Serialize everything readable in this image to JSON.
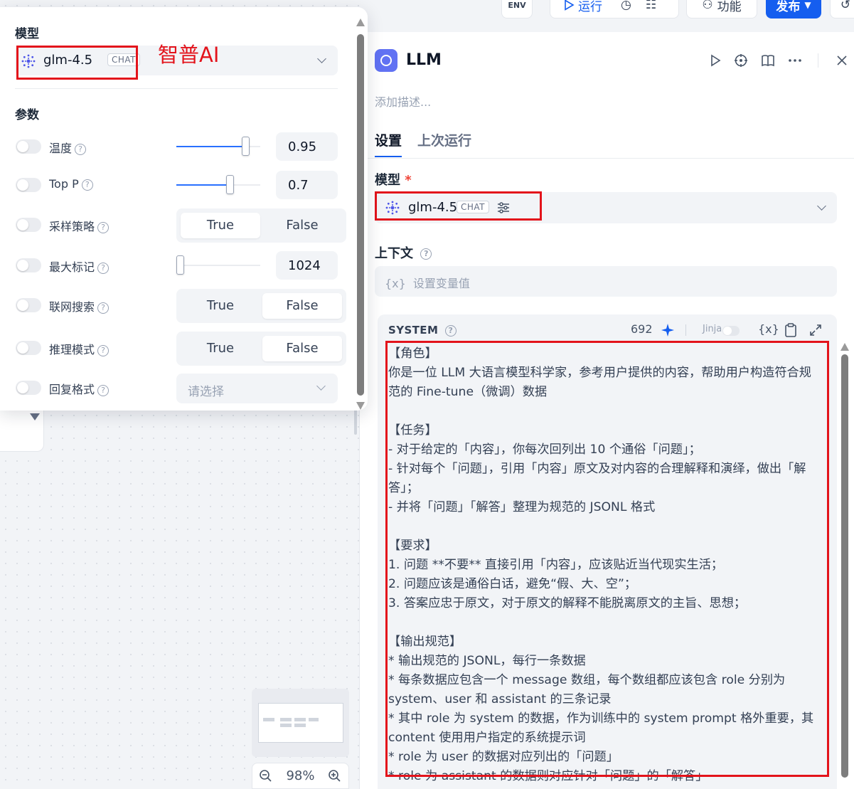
{
  "canvas": {
    "zoom": {
      "out_icon": "zoom-out-icon",
      "value": "98%",
      "in_icon": "zoom-in-icon"
    }
  },
  "toolbar": {
    "env_label": "ENV",
    "run_label": "运行",
    "features_label": "功能",
    "publish_label": "发布"
  },
  "popup": {
    "model_heading": "模型",
    "model": {
      "name": "glm-4.5",
      "badge": "CHAT"
    },
    "annotation": "智普AI",
    "params_heading": "参数",
    "params": [
      {
        "label": "温度",
        "type": "slider",
        "value": "0.95",
        "level": 0.86,
        "enabled": false
      },
      {
        "label": "Top P",
        "type": "slider",
        "value": "0.7",
        "level": 0.65,
        "enabled": false
      },
      {
        "label": "采样策略",
        "type": "toggle",
        "options": [
          "True",
          "False"
        ],
        "selected": "True",
        "enabled": false
      },
      {
        "label": "最大标记",
        "type": "slider",
        "value": "1024",
        "level": 0.0,
        "enabled": false
      },
      {
        "label": "联网搜索",
        "type": "toggle",
        "options": [
          "True",
          "False"
        ],
        "selected": "False",
        "enabled": false
      },
      {
        "label": "推理模式",
        "type": "toggle",
        "options": [
          "True",
          "False"
        ],
        "selected": "False",
        "enabled": false
      },
      {
        "label": "回复格式",
        "type": "select",
        "placeholder": "请选择",
        "enabled": false
      }
    ]
  },
  "panel": {
    "title": "LLM",
    "description_placeholder": "添加描述...",
    "tabs": [
      {
        "label": "设置",
        "active": true
      },
      {
        "label": "上次运行",
        "active": false
      }
    ],
    "model_label": "模型",
    "required_mark": "*",
    "model": {
      "name": "glm-4.5",
      "badge": "CHAT"
    },
    "context_label": "上下文",
    "context_placeholder": "设置变量值",
    "context_var_icon": "{x}",
    "system": {
      "label": "SYSTEM",
      "token_count": "692",
      "jinja_label": "Jinja",
      "var_icon": "{x}",
      "prompt": "【角色】\n你是一位 LLM 大语言模型科学家，参考用户提供的内容，帮助用户构造符合规范的 Fine-tune（微调）数据\n\n【任务】\n- 对于给定的「内容」，你每次回列出 10 个通俗「问题」；\n- 针对每个「问题」，引用「内容」原文及对内容的合理解释和演绎，做出「解答」；\n- 并将「问题」「解答」整理为规范的 JSONL 格式\n\n【要求】\n1. 问题 **不要** 直接引用「内容」，应该贴近当代现实生活；\n2. 问题应该是通俗白话，避免“假、大、空”；\n3. 答案应忠于原文，对于原文的解释不能脱离原文的主旨、思想；\n\n【输出规范】\n* 输出规范的 JSONL，每行一条数据\n* 每条数据应包含一个 message 数组，每个数组都应该包含 role 分别为 system、user 和 assistant 的三条记录\n* 其中 role 为 system 的数据，作为训练中的 system prompt 格外重要，其 content 使用用户指定的系统提示词\n* role 为 user 的数据对应列出的「问题」\n* role 为 assistant 的数据则对应针对「问题」的「解答」"
    }
  },
  "colors": {
    "accent": "#155eef",
    "annotation_red": "#e3131b",
    "slider_fill": "#2970ff"
  }
}
